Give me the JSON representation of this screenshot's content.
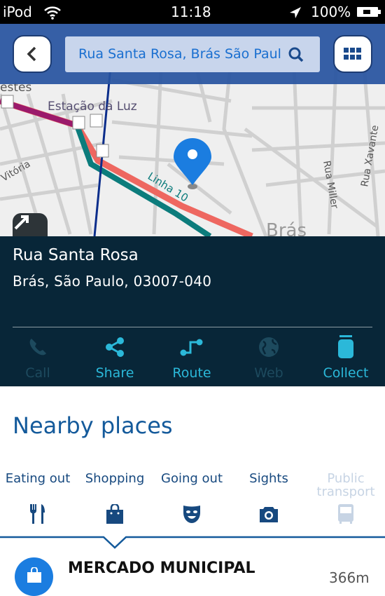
{
  "status_bar": {
    "device": "iPod",
    "time": "11:18",
    "battery": "100%"
  },
  "header": {
    "search_value": "Rua Santa Rosa, Brás São Paul",
    "icons": [
      "back-icon",
      "search-icon",
      "grid-menu-icon"
    ]
  },
  "map": {
    "labels": {
      "station": "Estação da Luz",
      "line": "Linha 10",
      "district": "Brás",
      "street1": "Vitória",
      "street2": "Rua Miller",
      "street3": "Rua Xavante",
      "partial": "estes"
    },
    "pin_color": "#1b7de0"
  },
  "place": {
    "title": "Rua Santa Rosa",
    "address": "Brás, São Paulo, 03007-040"
  },
  "actions": [
    {
      "label": "Call",
      "enabled": false
    },
    {
      "label": "Share",
      "enabled": true
    },
    {
      "label": "Route",
      "enabled": true
    },
    {
      "label": "Web",
      "enabled": false
    },
    {
      "label": "Collect",
      "enabled": true
    }
  ],
  "nearby": {
    "title": "Nearby places",
    "categories": [
      {
        "label": "Eating out",
        "icon": "fork-knife-icon",
        "enabled": true
      },
      {
        "label": "Shopping",
        "icon": "shopping-bag-icon",
        "enabled": true,
        "selected": true
      },
      {
        "label": "Going out",
        "icon": "mask-icon",
        "enabled": true
      },
      {
        "label": "Sights",
        "icon": "camera-icon",
        "enabled": true
      },
      {
        "label": "Public transport",
        "icon": "bus-icon",
        "enabled": false
      }
    ],
    "results": [
      {
        "name": "MERCADO MUNICIPAL",
        "distance": "366m"
      }
    ]
  },
  "colors": {
    "accent": "#2bb8d9",
    "panel": "#082638",
    "header": "#2854a0",
    "brand": "#145a9b"
  }
}
